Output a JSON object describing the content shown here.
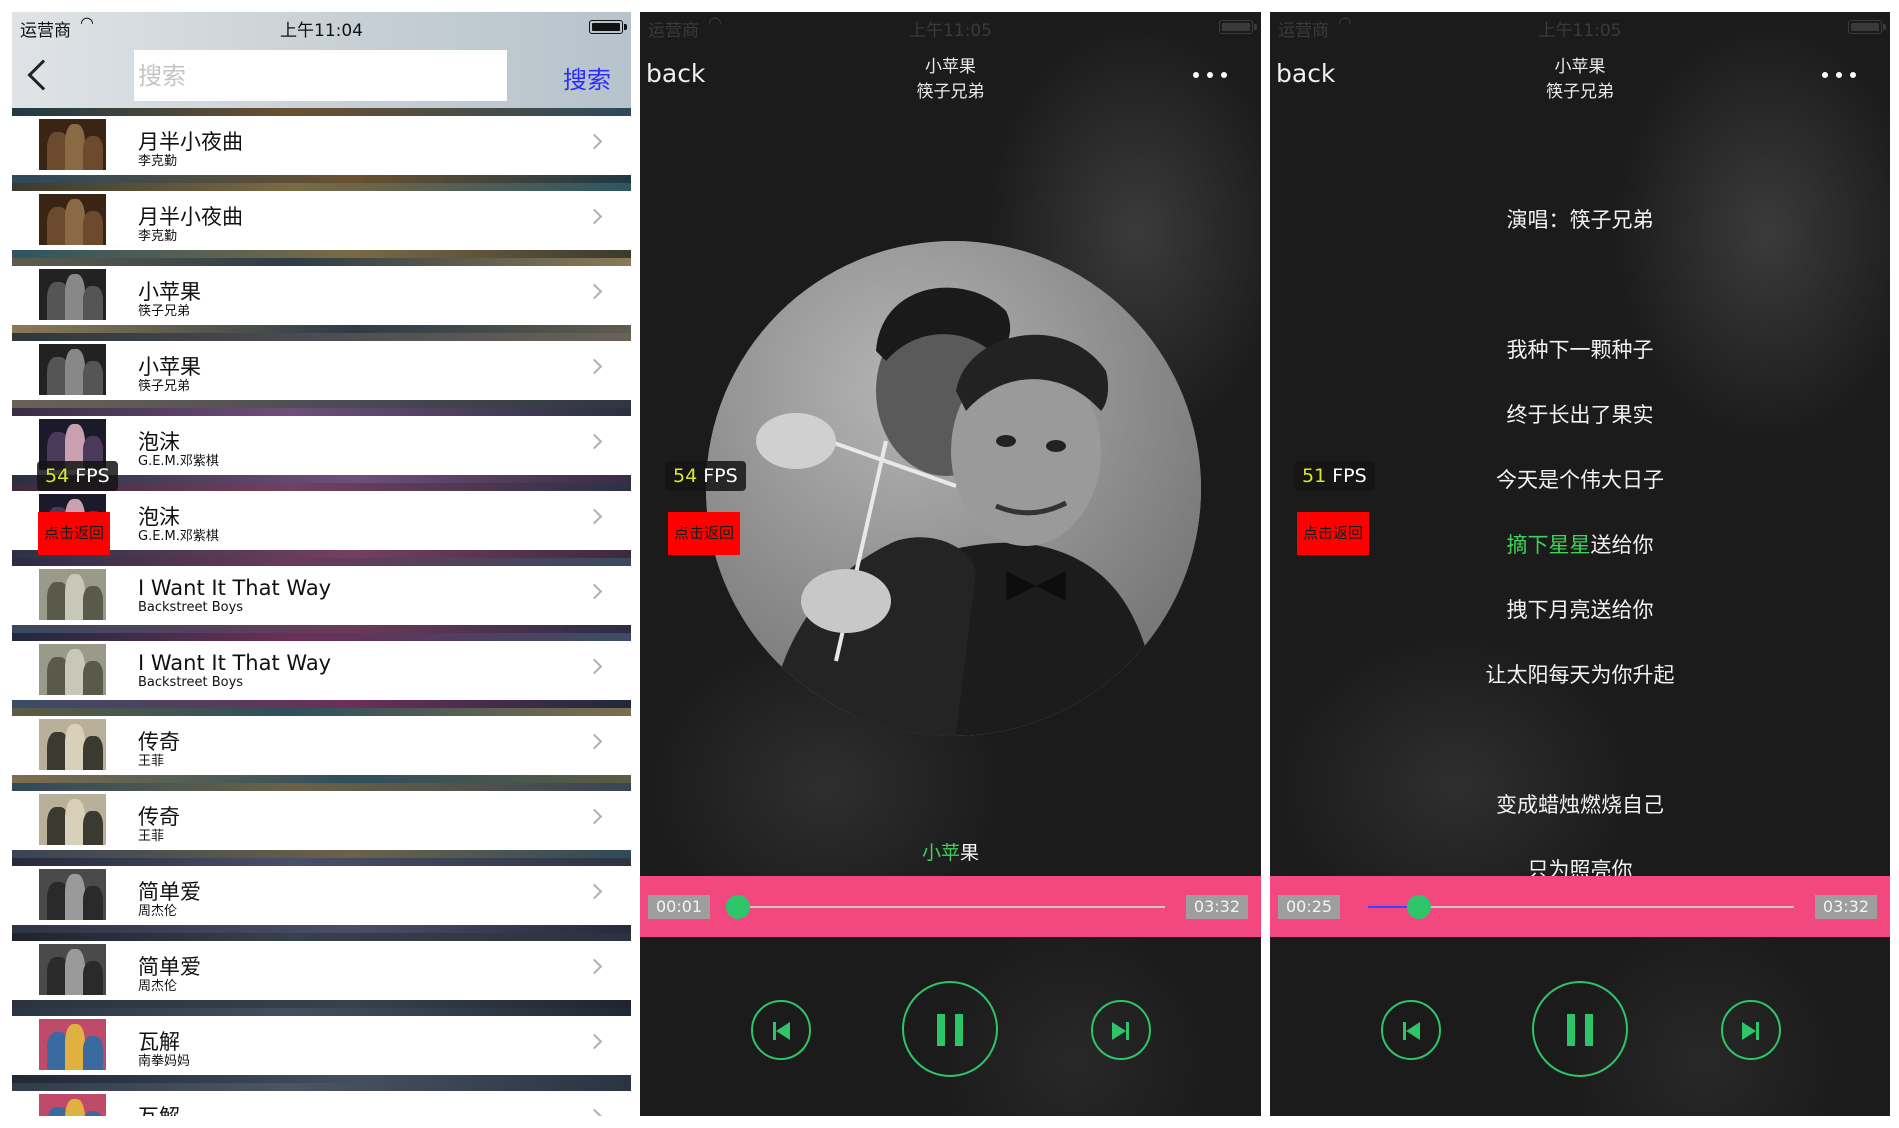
{
  "status": {
    "carrier": "运营商",
    "list_time": "上午11:04",
    "player_time": "上午11:05"
  },
  "search": {
    "placeholder": "搜索",
    "button": "搜索"
  },
  "songs": [
    {
      "title": "月半小夜曲",
      "artist": "李克勤"
    },
    {
      "title": "月半小夜曲",
      "artist": "李克勤"
    },
    {
      "title": "小苹果",
      "artist": "筷子兄弟"
    },
    {
      "title": "小苹果",
      "artist": "筷子兄弟"
    },
    {
      "title": "泡沫",
      "artist": "G.E.M.邓紫棋"
    },
    {
      "title": "泡沫",
      "artist": "G.E.M.邓紫棋"
    },
    {
      "title": "I Want It That Way",
      "artist": "Backstreet Boys"
    },
    {
      "title": "I Want It That Way",
      "artist": "Backstreet Boys"
    },
    {
      "title": "传奇",
      "artist": "王菲"
    },
    {
      "title": "传奇",
      "artist": "王菲"
    },
    {
      "title": "简单爱",
      "artist": "周杰伦"
    },
    {
      "title": "简单爱",
      "artist": "周杰伦"
    },
    {
      "title": "瓦解",
      "artist": "南拳妈妈"
    },
    {
      "title": "瓦解",
      "artist": ""
    }
  ],
  "overlay": {
    "fps_unit": "FPS",
    "list_fps": "54",
    "player_fps": "54",
    "lyrics_fps": "51",
    "tap_back": "点击返回"
  },
  "player": {
    "back": "back",
    "song": "小苹果",
    "artist": "筷子兄弟",
    "current_lyric_sung": "小苹",
    "current_lyric_rest": "果",
    "start_time": "00:01",
    "end_time": "03:32",
    "progress": 0.0
  },
  "lyrics_view": {
    "back": "back",
    "song": "小苹果",
    "artist": "筷子兄弟",
    "lines": [
      {
        "text": "演唱：筷子兄弟"
      },
      {
        "text": "我种下一颗种子"
      },
      {
        "text": "终于长出了果实"
      },
      {
        "text": "今天是个伟大日子"
      },
      {
        "text": "摘下星星送给你"
      },
      {
        "text": "拽下月亮送给你"
      },
      {
        "text": "让太阳每天为你升起"
      },
      {
        "text": "变成蜡烛燃烧自己"
      },
      {
        "text": "只为照亮你"
      }
    ],
    "active_sung": "摘下星星",
    "active_rest": "送给你",
    "start_time": "00:25",
    "end_time": "03:32",
    "progress": 0.12
  },
  "colors": {
    "accent_green": "#2ec46a",
    "progress_bar": "#f2487f",
    "search_button": "#2b2bff",
    "tap_back_bg": "#ff0000"
  }
}
